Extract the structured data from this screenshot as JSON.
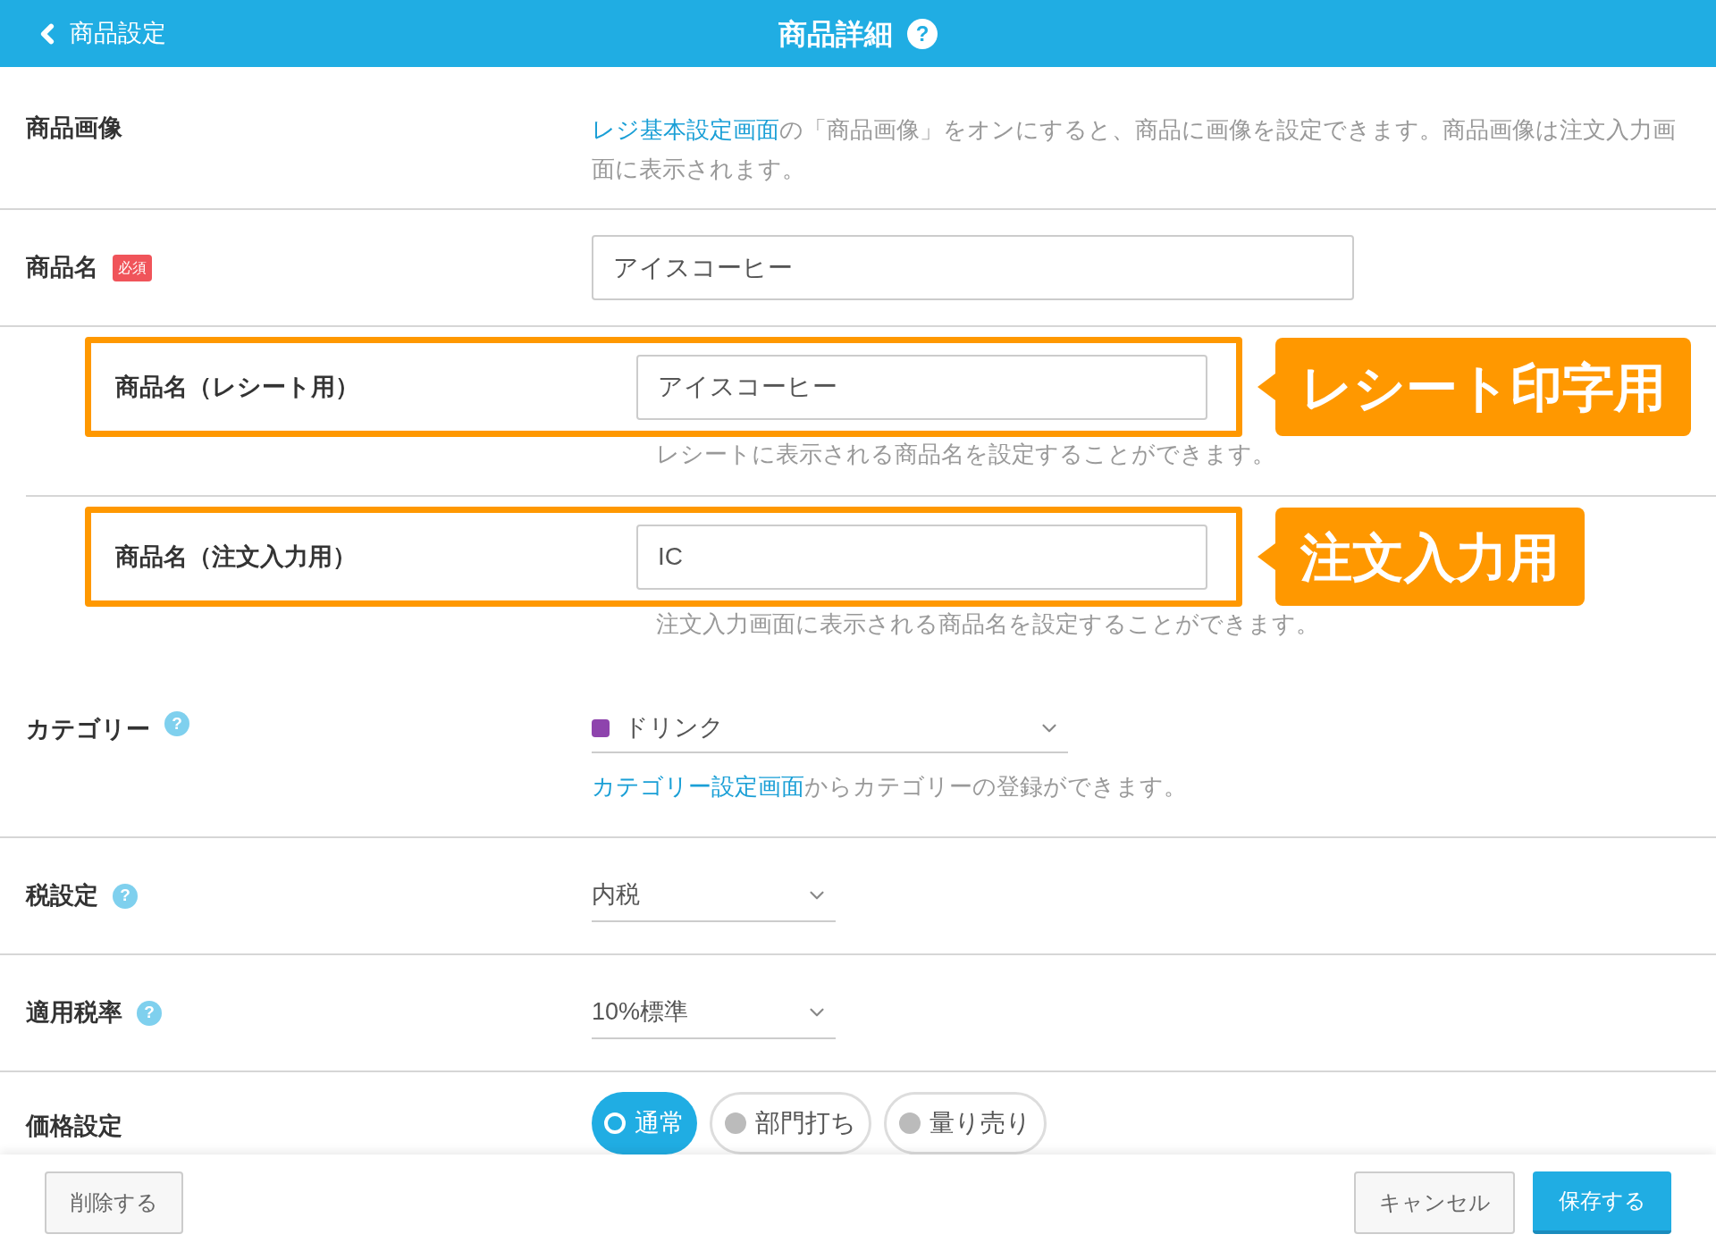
{
  "header": {
    "back_label": "商品設定",
    "title": "商品詳細",
    "help_icon_text": "?"
  },
  "image_row": {
    "label": "商品画像",
    "link": "レジ基本設定画面",
    "text": "の「商品画像」をオンにすると、商品に画像を設定できます。商品画像は注文入力画面に表示されます。"
  },
  "name_row": {
    "label": "商品名",
    "badge": "必須",
    "value": "アイスコーヒー"
  },
  "sub_names": [
    {
      "label": "商品名（レシート用）",
      "value": "アイスコーヒー",
      "hint": "レシートに表示される商品名を設定することができます。",
      "callout": "レシート印字用"
    },
    {
      "label": "商品名（注文入力用）",
      "value": "IC",
      "hint": "注文入力画面に表示される商品名を設定することができます。",
      "callout": "注文入力用"
    }
  ],
  "category_row": {
    "label": "カテゴリー",
    "help": "?",
    "value": "ドリンク",
    "color": "#8e44ad",
    "link": "カテゴリー設定画面",
    "text": "からカテゴリーの登録ができます。"
  },
  "select_rows": [
    {
      "label": "税設定",
      "help": "?",
      "value": "内税"
    },
    {
      "label": "適用税率",
      "help": "?",
      "value": "10%標準"
    }
  ],
  "price_row": {
    "label": "価格設定",
    "options": [
      {
        "label": "通常",
        "selected": true
      },
      {
        "label": "部門打ち",
        "selected": false
      },
      {
        "label": "量り売り",
        "selected": false
      }
    ]
  },
  "footer": {
    "delete": "削除する",
    "cancel": "キャンセル",
    "save": "保存する"
  }
}
